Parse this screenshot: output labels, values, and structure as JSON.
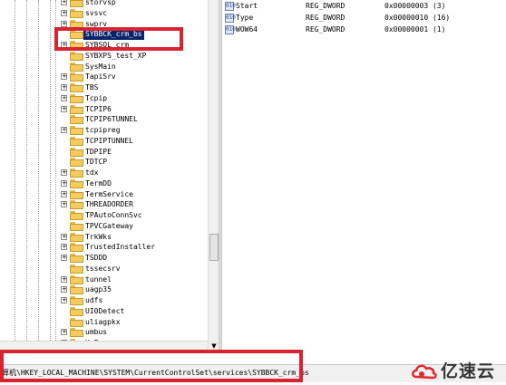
{
  "tree": {
    "items": [
      {
        "label": "storvsp",
        "expander": "+",
        "selected": false
      },
      {
        "label": "svsvc",
        "expander": "+",
        "selected": false
      },
      {
        "label": "swprv",
        "expander": "+",
        "selected": false
      },
      {
        "label": "SYBBCK_crm_bs",
        "expander": "",
        "selected": true
      },
      {
        "label": "SYBSQL_crm",
        "expander": "+",
        "selected": false
      },
      {
        "label": "SYBXPS_test_XP",
        "expander": "",
        "selected": false
      },
      {
        "label": "SysMain",
        "expander": "",
        "selected": false
      },
      {
        "label": "TapiSrv",
        "expander": "+",
        "selected": false
      },
      {
        "label": "TBS",
        "expander": "+",
        "selected": false
      },
      {
        "label": "Tcpip",
        "expander": "+",
        "selected": false
      },
      {
        "label": "TCPIP6",
        "expander": "+",
        "selected": false
      },
      {
        "label": "TCPIP6TUNNEL",
        "expander": "",
        "selected": false
      },
      {
        "label": "tcpipreg",
        "expander": "+",
        "selected": false
      },
      {
        "label": "TCPIPTUNNEL",
        "expander": "",
        "selected": false
      },
      {
        "label": "TDPIPE",
        "expander": "",
        "selected": false
      },
      {
        "label": "TDTCP",
        "expander": "",
        "selected": false
      },
      {
        "label": "tdx",
        "expander": "+",
        "selected": false
      },
      {
        "label": "TermDD",
        "expander": "+",
        "selected": false
      },
      {
        "label": "TermService",
        "expander": "+",
        "selected": false
      },
      {
        "label": "THREADORDER",
        "expander": "+",
        "selected": false
      },
      {
        "label": "TPAutoConnSvc",
        "expander": "",
        "selected": false
      },
      {
        "label": "TPVCGateway",
        "expander": "",
        "selected": false
      },
      {
        "label": "TrkWks",
        "expander": "+",
        "selected": false
      },
      {
        "label": "TrustedInstaller",
        "expander": "+",
        "selected": false
      },
      {
        "label": "TSDDD",
        "expander": "+",
        "selected": false
      },
      {
        "label": "tssecsrv",
        "expander": "",
        "selected": false
      },
      {
        "label": "tunnel",
        "expander": "+",
        "selected": false
      },
      {
        "label": "uagp35",
        "expander": "+",
        "selected": false
      },
      {
        "label": "udfs",
        "expander": "+",
        "selected": false
      },
      {
        "label": "UI0Detect",
        "expander": "",
        "selected": false
      },
      {
        "label": "uliagpkx",
        "expander": "",
        "selected": false
      },
      {
        "label": "umbus",
        "expander": "+",
        "selected": false
      },
      {
        "label": "UmPass",
        "expander": "+",
        "selected": false
      }
    ]
  },
  "values": {
    "rows": [
      {
        "icon": "010",
        "name": "Start",
        "type": "REG_DWORD",
        "data": "0x00000003 (3)"
      },
      {
        "icon": "010",
        "name": "Type",
        "type": "REG_DWORD",
        "data": "0x00000010 (16)"
      },
      {
        "icon": "010",
        "name": "WOW64",
        "type": "REG_DWORD",
        "data": "0x00000001 (1)"
      }
    ]
  },
  "status": {
    "path": "算机\\HKEY_LOCAL_MACHINE\\SYSTEM\\CurrentControlSet\\services\\SYBBCK_crm_bs"
  },
  "scroll": {
    "down_arrow": "▼"
  },
  "logo": {
    "text": "亿速云"
  },
  "colors": {
    "highlight_box": "#d9232f",
    "selection": "#0a246a",
    "folder": "#f2cc5e",
    "logo_red": "#e0272e"
  }
}
